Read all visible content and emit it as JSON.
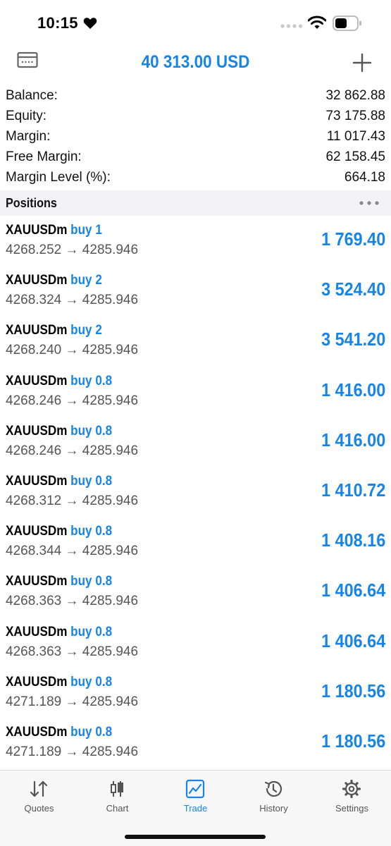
{
  "status_bar": {
    "time": "10:15"
  },
  "header": {
    "title": "40 313.00 USD"
  },
  "summary": [
    {
      "label": "Balance:",
      "value": "32 862.88"
    },
    {
      "label": "Equity:",
      "value": "73 175.88"
    },
    {
      "label": "Margin:",
      "value": "11 017.43"
    },
    {
      "label": "Free Margin:",
      "value": "62 158.45"
    },
    {
      "label": "Margin Level (%):",
      "value": "664.18"
    }
  ],
  "positions_section": {
    "title": "Positions"
  },
  "positions": [
    {
      "symbol": "XAUUSDm",
      "type": "buy 1",
      "prices": "4268.252 → 4285.946",
      "profit": "1 769.40"
    },
    {
      "symbol": "XAUUSDm",
      "type": "buy 2",
      "prices": "4268.324 → 4285.946",
      "profit": "3 524.40"
    },
    {
      "symbol": "XAUUSDm",
      "type": "buy 2",
      "prices": "4268.240 → 4285.946",
      "profit": "3 541.20"
    },
    {
      "symbol": "XAUUSDm",
      "type": "buy 0.8",
      "prices": "4268.246 → 4285.946",
      "profit": "1 416.00"
    },
    {
      "symbol": "XAUUSDm",
      "type": "buy 0.8",
      "prices": "4268.246 → 4285.946",
      "profit": "1 416.00"
    },
    {
      "symbol": "XAUUSDm",
      "type": "buy 0.8",
      "prices": "4268.312 → 4285.946",
      "profit": "1 410.72"
    },
    {
      "symbol": "XAUUSDm",
      "type": "buy 0.8",
      "prices": "4268.344 → 4285.946",
      "profit": "1 408.16"
    },
    {
      "symbol": "XAUUSDm",
      "type": "buy 0.8",
      "prices": "4268.363 → 4285.946",
      "profit": "1 406.64"
    },
    {
      "symbol": "XAUUSDm",
      "type": "buy 0.8",
      "prices": "4268.363 → 4285.946",
      "profit": "1 406.64"
    },
    {
      "symbol": "XAUUSDm",
      "type": "buy 0.8",
      "prices": "4271.189 → 4285.946",
      "profit": "1 180.56"
    },
    {
      "symbol": "XAUUSDm",
      "type": "buy 0.8",
      "prices": "4271.189 → 4285.946",
      "profit": "1 180.56"
    }
  ],
  "tabs": [
    {
      "label": "Quotes",
      "icon": "quotes-icon",
      "active": false
    },
    {
      "label": "Chart",
      "icon": "chart-icon",
      "active": false
    },
    {
      "label": "Trade",
      "icon": "trade-icon",
      "active": true
    },
    {
      "label": "History",
      "icon": "history-icon",
      "active": false
    },
    {
      "label": "Settings",
      "icon": "settings-icon",
      "active": false
    }
  ],
  "colors": {
    "accent": "#1784e7",
    "text": "#000000",
    "secondary_text": "#555555",
    "section_bg": "#f3f3f5"
  }
}
